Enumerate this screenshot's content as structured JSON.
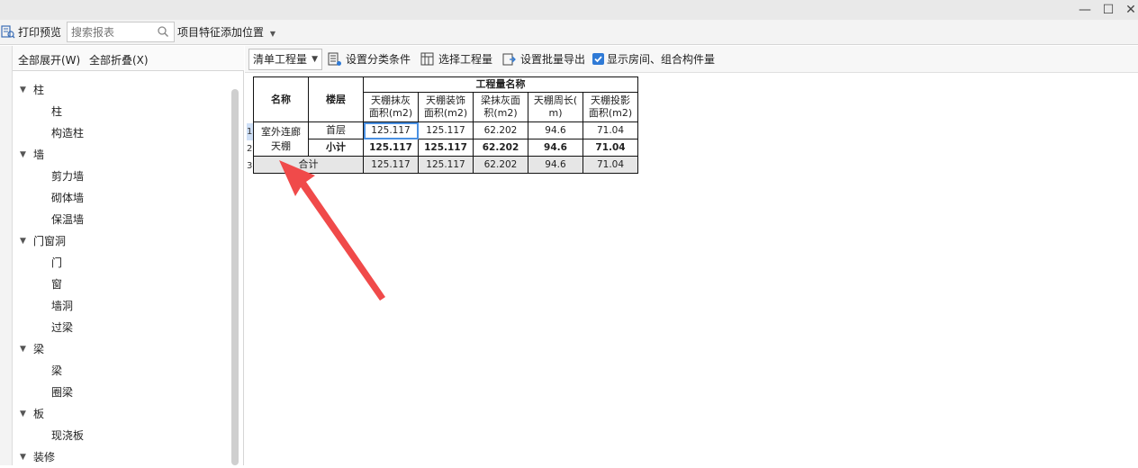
{
  "toolbar1": {
    "print_preview": "打印预览",
    "search_placeholder": "搜索报表",
    "position_menu": "项目特征添加位置"
  },
  "left_panel": {
    "expand_all": "全部展开(W)",
    "collapse_all": "全部折叠(X)",
    "tree": [
      {
        "type": "group",
        "label": "柱"
      },
      {
        "type": "leaf",
        "label": "柱"
      },
      {
        "type": "leaf",
        "label": "构造柱"
      },
      {
        "type": "group",
        "label": "墙"
      },
      {
        "type": "leaf",
        "label": "剪力墙"
      },
      {
        "type": "leaf",
        "label": "砌体墙"
      },
      {
        "type": "leaf",
        "label": "保温墙"
      },
      {
        "type": "group",
        "label": "门窗洞"
      },
      {
        "type": "leaf",
        "label": "门"
      },
      {
        "type": "leaf",
        "label": "窗"
      },
      {
        "type": "leaf",
        "label": "墙洞"
      },
      {
        "type": "leaf",
        "label": "过梁"
      },
      {
        "type": "group",
        "label": "梁"
      },
      {
        "type": "leaf",
        "label": "梁"
      },
      {
        "type": "leaf",
        "label": "圈梁"
      },
      {
        "type": "group",
        "label": "板"
      },
      {
        "type": "leaf",
        "label": "现浇板"
      },
      {
        "type": "group",
        "label": "装修"
      }
    ]
  },
  "toolbar2": {
    "select_value": "清单工程量",
    "set_category": "设置分类条件",
    "select_quantity": "选择工程量",
    "batch_export": "设置批量导出",
    "show_rooms": "显示房间、组合构件量",
    "show_rooms_checked": true
  },
  "table": {
    "col_name": "名称",
    "col_floor": "楼层",
    "group_header": "工程量名称",
    "headers": [
      [
        "天棚抹灰",
        "面积(m2)"
      ],
      [
        "天棚装饰",
        "面积(m2)"
      ],
      [
        "梁抹灰面",
        "积(m2)"
      ],
      [
        "天棚周长(",
        "m)"
      ],
      [
        "天棚投影",
        "面积(m2)"
      ]
    ],
    "row_numbers": [
      "1",
      "2",
      "3"
    ],
    "name_value": [
      "室外连廊",
      "天棚"
    ],
    "rows": [
      {
        "floor": "首层",
        "values": [
          "125.117",
          "125.117",
          "62.202",
          "94.6",
          "71.04"
        ]
      },
      {
        "floor": "小计",
        "values": [
          "125.117",
          "125.117",
          "62.202",
          "94.6",
          "71.04"
        ]
      }
    ],
    "total": {
      "label": "合计",
      "values": [
        "125.117",
        "125.117",
        "62.202",
        "94.6",
        "71.04"
      ]
    }
  },
  "colors": {
    "accent": "#2f7ad6",
    "arrow": "#f04a4a"
  }
}
